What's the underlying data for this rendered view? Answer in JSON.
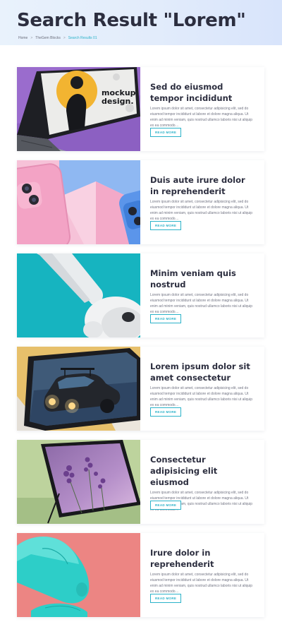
{
  "header": {
    "title": "Search Result \"Lorem\"",
    "breadcrumb": [
      "Home",
      "TheGem Blocks",
      "Search Results 01"
    ],
    "breadcrumb_separator": ">"
  },
  "colors": {
    "accent": "#2bb2c9",
    "heading": "#2c2e3f"
  },
  "posts": [
    {
      "title": "Sed do eiusmod tempor incididunt",
      "excerpt": "Lorem ipsum dolor sit amet, consectetur adipisicing elit, sed do eiusmod tempor incididunt ut labore et dolore magna aliqua. Ut enim ad minim veniam, quis nostrud ullamco laboris nisi ut aliquip ex ea commodo…",
      "more": "READ MORE",
      "image_text": "mockup design."
    },
    {
      "title": "Duis aute irure dolor in reprehenderit",
      "excerpt": "Lorem ipsum dolor sit amet, consectetur adipisicing elit, sed do eiusmod tempor incididunt ut labore et dolore magna aliqua. Ut enim ad minim veniam, quis nostrud ullamco laboris nisi ut aliquip ex ea commodo…",
      "more": "READ MORE"
    },
    {
      "title": "Minim veniam quis nostrud",
      "excerpt": "Lorem ipsum dolor sit amet, consectetur adipisicing elit, sed do eiusmod tempor incididunt ut labore et dolore magna aliqua. Ut enim ad minim veniam, quis nostrud ullamco laboris nisi ut aliquip ex ea commodo…",
      "more": "READ MORE"
    },
    {
      "title": "Lorem ipsum dolor sit amet consectetur",
      "excerpt": "Lorem ipsum dolor sit amet, consectetur adipisicing elit, sed do eiusmod tempor incididunt ut labore et dolore magna aliqua. Ut enim ad minim veniam, quis nostrud ullamco laboris nisi ut aliquip ex ea commodo…",
      "more": "READ MORE"
    },
    {
      "title": "Consectetur adipisicing elit eiusmod",
      "excerpt": "Lorem ipsum dolor sit amet, consectetur adipisicing elit, sed do eiusmod tempor incididunt ut labore et dolore magna aliqua. Ut enim ad minim veniam, quis nostrud ullamco laboris nisi ut aliquip ex ea commodo…",
      "more": "READ MORE"
    },
    {
      "title": "Irure dolor in reprehenderit",
      "excerpt": "Lorem ipsum dolor sit amet, consectetur adipisicing elit, sed do eiusmod tempor incididunt ut labore et dolore magna aliqua. Ut enim ad minim veniam, quis nostrud ullamco laboris nisi ut aliquip ex ea commodo…",
      "more": "READ MORE"
    }
  ]
}
